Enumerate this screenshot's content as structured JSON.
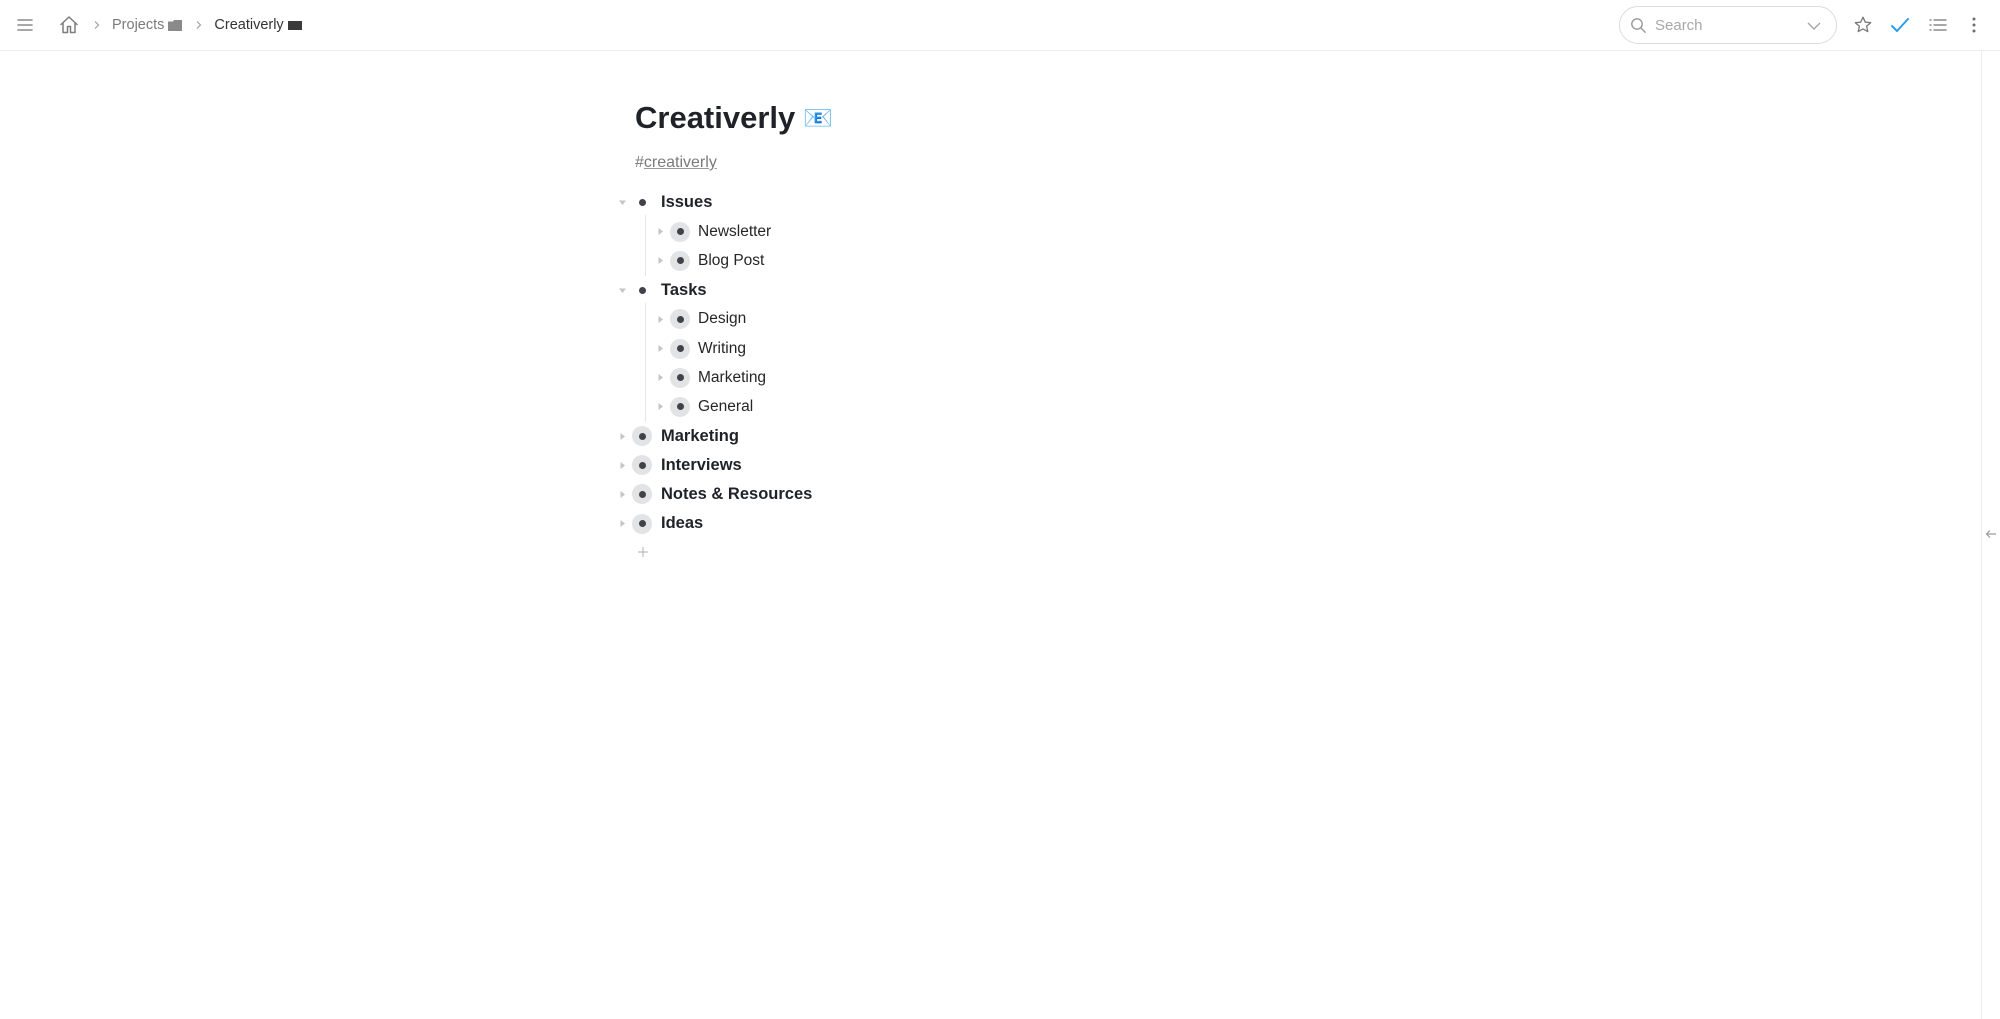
{
  "header": {
    "menu_icon": "hamburger-menu-icon",
    "home_icon": "home-icon",
    "breadcrumbs": [
      {
        "label": "Projects",
        "icon": "folder-icon",
        "icon_color": "#8a8a8a"
      },
      {
        "label": "Creativerly",
        "icon": "folder-icon",
        "icon_color": "#3a3a3a"
      }
    ],
    "search": {
      "placeholder": "Search",
      "value": ""
    },
    "actions": [
      {
        "name": "star-icon"
      },
      {
        "name": "check-icon",
        "color": "#2f9ee8"
      },
      {
        "name": "list-icon"
      },
      {
        "name": "more-vertical-icon"
      }
    ]
  },
  "page": {
    "title": "Creativerly",
    "title_emoji": "📧",
    "tag_hash": "#",
    "tag": "creativerly"
  },
  "tree": [
    {
      "label": "Issues",
      "expanded": true,
      "children": [
        {
          "label": "Newsletter"
        },
        {
          "label": "Blog Post"
        }
      ]
    },
    {
      "label": "Tasks",
      "expanded": true,
      "children": [
        {
          "label": "Design"
        },
        {
          "label": "Writing"
        },
        {
          "label": "Marketing"
        },
        {
          "label": "General"
        }
      ]
    },
    {
      "label": "Marketing",
      "expanded": false
    },
    {
      "label": "Interviews",
      "expanded": false
    },
    {
      "label": "Notes & Resources",
      "expanded": false
    },
    {
      "label": "Ideas",
      "expanded": false
    }
  ],
  "sidebar_toggle_icon": "arrow-left-icon"
}
